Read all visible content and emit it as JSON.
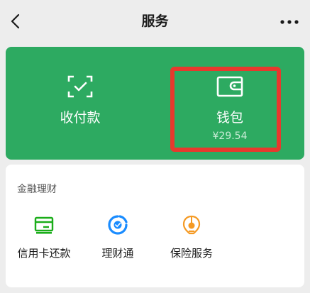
{
  "header": {
    "title": "服务"
  },
  "wallet_card": {
    "pay_label": "收付款",
    "wallet_label": "钱包",
    "wallet_balance": "¥29.54"
  },
  "finance": {
    "section_title": "金融理财",
    "items": [
      {
        "label": "信用卡还款",
        "icon": "credit-card-icon"
      },
      {
        "label": "理财通",
        "icon": "licaitong-icon"
      },
      {
        "label": "保险服务",
        "icon": "insurance-icon"
      }
    ]
  },
  "colors": {
    "primary_green": "#2daa61",
    "highlight_red": "#e8392d",
    "credit_green": "#1aad19",
    "licaitong_blue": "#1a8cff",
    "insurance_orange": "#f59a23"
  }
}
